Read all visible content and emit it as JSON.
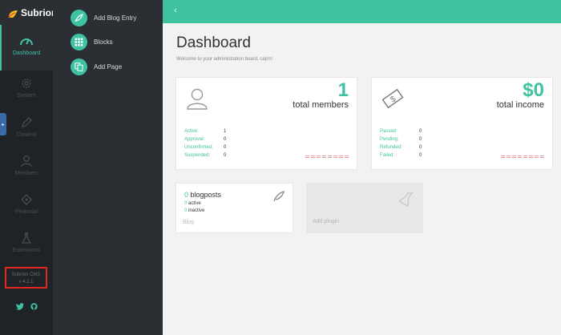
{
  "brand": {
    "name": "Subrion"
  },
  "rail": {
    "items": [
      {
        "label": "Dashboard",
        "icon": "gauge-icon",
        "active": true
      },
      {
        "label": "System",
        "icon": "cog-icon"
      },
      {
        "label": "Content",
        "icon": "pencil-icon"
      },
      {
        "label": "Members",
        "icon": "user-icon"
      },
      {
        "label": "Financial",
        "icon": "tag-icon"
      },
      {
        "label": "Extensions",
        "icon": "flask-icon"
      }
    ],
    "version_line1": "Subrion CMS",
    "version_line2": "v 4.2.1"
  },
  "quick_actions": [
    {
      "label": "Add Blog Entry",
      "icon": "quill-icon"
    },
    {
      "label": "Blocks",
      "icon": "grid-icon"
    },
    {
      "label": "Add Page",
      "icon": "pages-icon"
    }
  ],
  "topbar": {
    "back_glyph": "‹"
  },
  "dashboard": {
    "title": "Dashboard",
    "subtitle": "Welcome to your administration board, cap'n!"
  },
  "members_card": {
    "value": "1",
    "label": "total members",
    "stats": [
      {
        "key": "Active:",
        "value": "1"
      },
      {
        "key": "Approval:",
        "value": "0"
      },
      {
        "key": "Unconfirmed:",
        "value": "0"
      },
      {
        "key": "Suspended:",
        "value": "0"
      }
    ]
  },
  "income_card": {
    "value": "$0",
    "label": "total income",
    "stats": [
      {
        "key": "Passed:",
        "value": "0"
      },
      {
        "key": "Pending:",
        "value": "0"
      },
      {
        "key": "Refunded:",
        "value": "0"
      },
      {
        "key": "Failed:",
        "value": "0"
      }
    ]
  },
  "blog_card": {
    "count": "0",
    "title_suffix": " blogposts",
    "active_count": "0",
    "active_label": " active",
    "inactive_count": "0",
    "inactive_label": " inactive",
    "footer": "Blog"
  },
  "plugin_card": {
    "label": "Add plugin"
  },
  "colors": {
    "accent": "#3ec2a0",
    "rail_bg": "#1f2226",
    "panel_bg": "#2b2e33",
    "highlight_box": "#e0261f"
  }
}
